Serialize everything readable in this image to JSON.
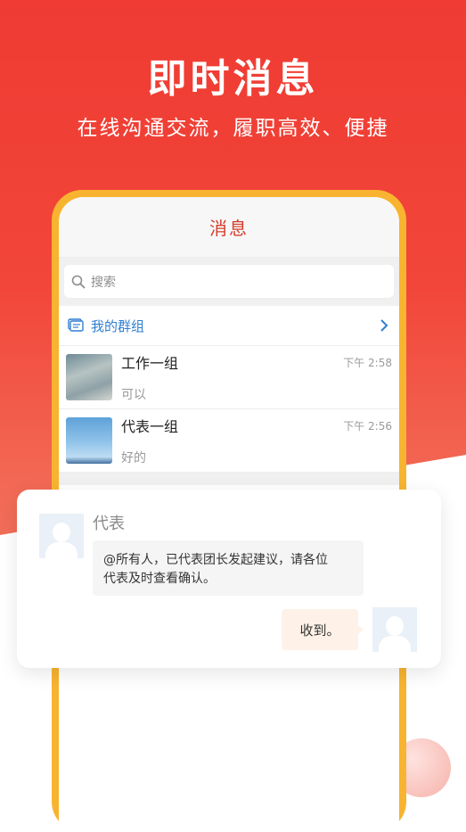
{
  "hero": {
    "title": "即时消息",
    "subtitle": "在线沟通交流，履职高效、便捷"
  },
  "phone": {
    "header_title": "消息",
    "search_placeholder": "搜索",
    "group_entry": {
      "label": "我的群组",
      "icon": "group-chat-icon",
      "chevron": "chevron-right-icon"
    },
    "chats": [
      {
        "name": "工作一组",
        "preview": "可以",
        "time": "下午 2:58",
        "avatar": "cloud-photo"
      },
      {
        "name": "代表一组",
        "preview": "好的",
        "time": "下午 2:56",
        "avatar": "sky-photo"
      }
    ]
  },
  "popup": {
    "sender": "代表",
    "message_line1": "@所有人，已代表团长发起建议，请各位",
    "message_line2": "代表及时查看确认。",
    "reply": "收到。"
  },
  "colors": {
    "brand_red": "#ef3b33",
    "header_title": "#d43c2a",
    "link_blue": "#2f7fd1",
    "phone_frame": "#f8b430"
  }
}
